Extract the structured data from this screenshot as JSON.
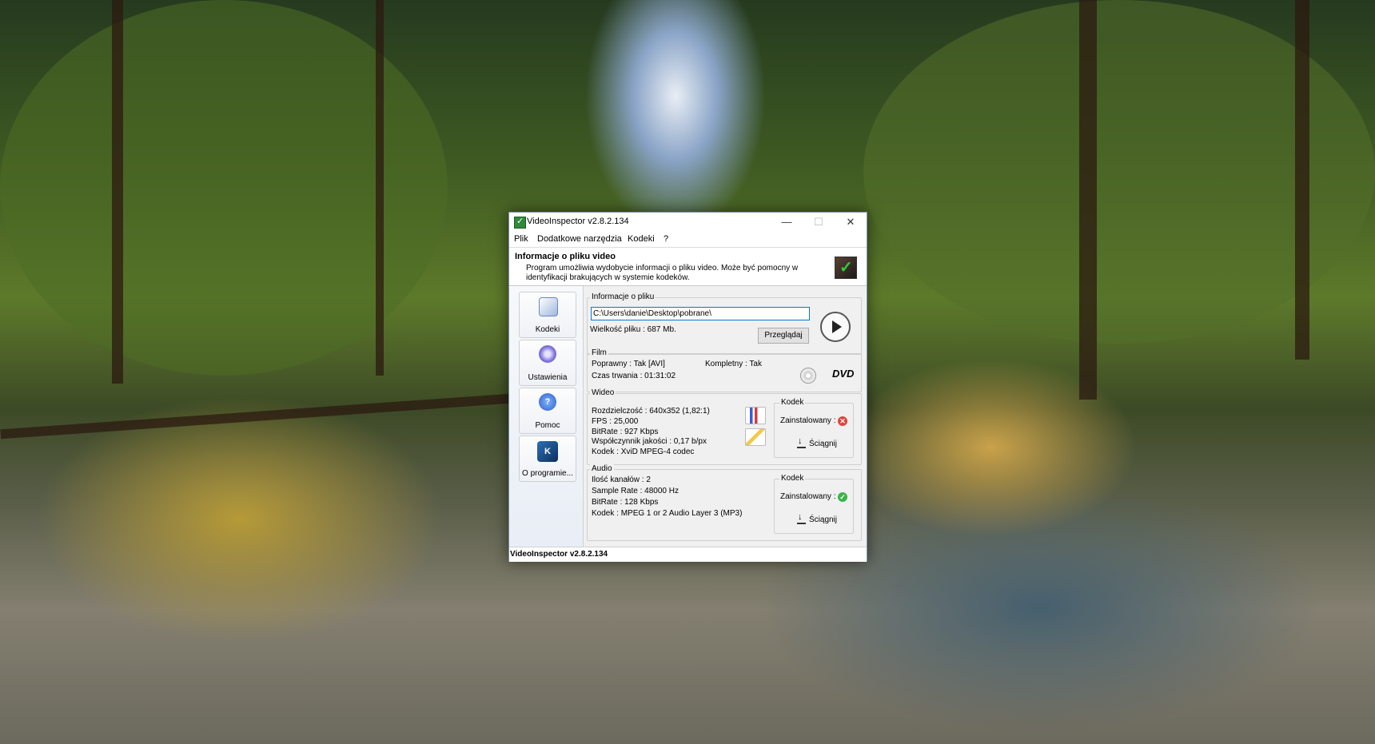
{
  "window": {
    "title": "VideoInspector v2.8.2.134",
    "controls": {
      "minimize": "—",
      "maximize": "☐",
      "close": "✕"
    }
  },
  "menu": [
    "Plik",
    "Dodatkowe narzędzia",
    "Kodeki",
    "?"
  ],
  "header": {
    "title": "Informacje o pliku video",
    "description": "Program umożliwia wydobycie informacji o pliku video. Może być pomocny w identyfikacji brakujących w systemie kodeków."
  },
  "sidebar": [
    {
      "label": "Kodeki",
      "icon": "codecs-icon"
    },
    {
      "label": "Ustawienia",
      "icon": "settings-gear-icon"
    },
    {
      "label": "Pomoc",
      "icon": "help-icon"
    },
    {
      "label": "O programie...",
      "icon": "about-icon"
    }
  ],
  "file_info": {
    "group_title": "Informacje o pliku",
    "path": "C:\\Users\\danie\\Desktop\\pobrane\\",
    "size": "Wielkość pliku : 687 Mb.",
    "browse_label": "Przeglądaj"
  },
  "film": {
    "group_title": "Film",
    "valid": "Poprawny : Tak [AVI]",
    "complete": "Kompletny : Tak",
    "duration": "Czas trwania : 01:31:02",
    "dvd_label": "DVD"
  },
  "video": {
    "group_title": "Wideo",
    "resolution": "Rozdzielczość : 640x352 (1,82:1)",
    "fps": "FPS : 25,000",
    "bitrate": "BitRate : 927 Kbps",
    "quality": "Współczynnik jakości : 0,17 b/px",
    "codec": "Kodek : XviD MPEG-4 codec",
    "codec_group_title": "Kodek",
    "installed_label": "Zainstalowany :",
    "installed_status": "not-installed",
    "download_label": "Ściągnij"
  },
  "audio": {
    "group_title": "Audio",
    "channels": "Ilość kanałów : 2",
    "sample_rate": "Sample Rate : 48000 Hz",
    "bitrate": "BitRate : 128 Kbps",
    "codec": "Kodek : MPEG 1 or 2 Audio Layer 3 (MP3)",
    "codec_group_title": "Kodek",
    "installed_label": "Zainstalowany :",
    "installed_status": "installed",
    "download_label": "Ściągnij"
  },
  "statusbar": {
    "text": "VideoInspector v2.8.2.134"
  },
  "colors": {
    "title_bg": "#ffffff",
    "input_border": "#0078d7",
    "error": "#e0443e",
    "ok": "#3bb54a"
  }
}
